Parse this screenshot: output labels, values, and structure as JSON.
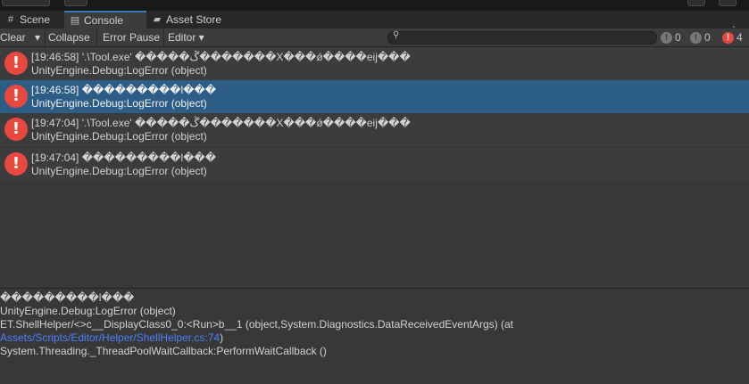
{
  "tabs": [
    {
      "label": "Scene",
      "icon": "grid-icon"
    },
    {
      "label": "Console",
      "icon": "console-icon"
    },
    {
      "label": "Asset Store",
      "icon": "shopping-bag-icon"
    }
  ],
  "toolbar": {
    "clear_label": "Clear",
    "clear_dropdown": "▾",
    "collapse_label": "Collapse",
    "error_pause_label": "Error Pause",
    "editor_label": "Editor ▾",
    "search_placeholder": "",
    "log_count": "0",
    "warning_count": "0",
    "error_count": "4"
  },
  "entries": [
    {
      "line1": "[19:46:58] '.\\Tool.exe' �����ڴ�������X���ǿ����eij���",
      "line2": "UnityEngine.Debug:LogError (object)"
    },
    {
      "line1": "[19:46:58] ���������l���",
      "line2": "UnityEngine.Debug:LogError (object)"
    },
    {
      "line1": "[19:47:04] '.\\Tool.exe' �����ڴ�������X���ǿ����eij���",
      "line2": "UnityEngine.Debug:LogError (object)"
    },
    {
      "line1": "[19:47:04] ���������l���",
      "line2": "UnityEngine.Debug:LogError (object)"
    }
  ],
  "detail": {
    "line1": "���������l���",
    "line2": "UnityEngine.Debug:LogError (object)",
    "line3": "ET.ShellHelper/<>c__DisplayClass0_0:<Run>b__1 (object,System.Diagnostics.DataReceivedEventArgs) (at",
    "line4_link": "Assets/Scripts/Editor/Helper/ShellHelper.cs:74",
    "line4_tail": ")",
    "line5": "System.Threading._ThreadPoolWaitCallback:PerformWaitCallback ()"
  },
  "colors": {
    "accent": "#3a79bb",
    "selection": "#2c5d87",
    "error": "#e8493e",
    "link": "#4c7eff"
  }
}
